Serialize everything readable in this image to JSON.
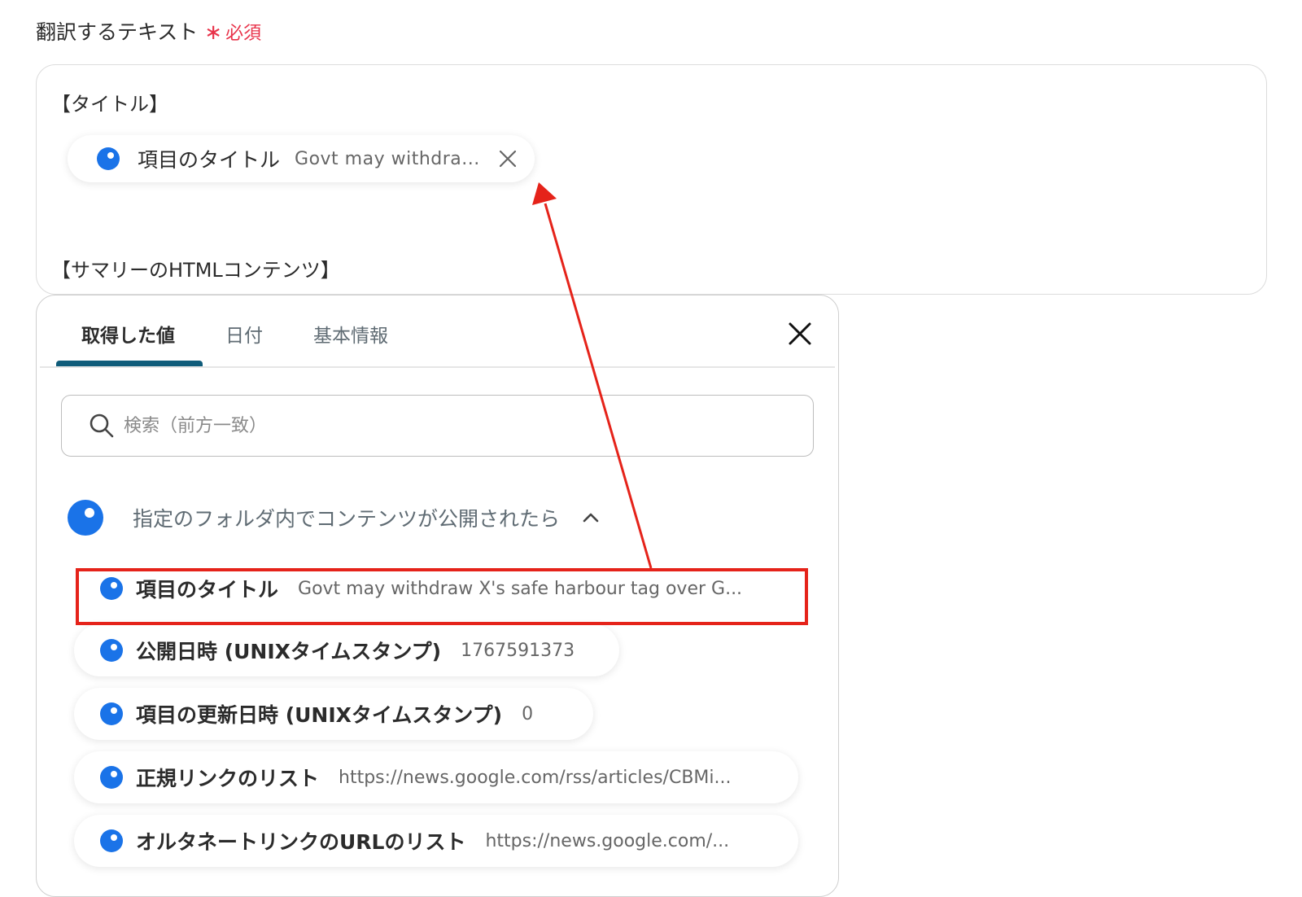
{
  "field": {
    "label": "翻訳するテキスト",
    "required_star": "∗",
    "required_text": "必須"
  },
  "editor": {
    "line1": "【タイトル】",
    "line2": "【サマリーのHTMLコンテンツ】",
    "token": {
      "label": "項目のタイトル",
      "value": "Govt may withdra..."
    }
  },
  "picker": {
    "tabs": [
      {
        "label": "取得した値",
        "active": true
      },
      {
        "label": "日付",
        "active": false
      },
      {
        "label": "基本情報",
        "active": false
      }
    ],
    "search": {
      "placeholder": "検索（前方一致）",
      "value": ""
    },
    "group": {
      "title": "指定のフォルダ内でコンテンツが公開されたら"
    },
    "items": [
      {
        "label": "項目のタイトル",
        "value": "Govt may withdraw X's safe harbour tag over G..."
      },
      {
        "label": "公開日時 (UNIXタイムスタンプ)",
        "value": "1767591373"
      },
      {
        "label": "項目の更新日時 (UNIXタイムスタンプ)",
        "value": "0"
      },
      {
        "label": "正規リンクのリスト",
        "value": "https://news.google.com/rss/articles/CBMi..."
      },
      {
        "label": "オルタネートリンクのURLのリスト",
        "value": "https://news.google.com/..."
      }
    ]
  },
  "colors": {
    "accent": "#1a73e8",
    "tab_underline": "#0f5c7a",
    "required": "#e8334a",
    "annotation": "#e5231a"
  }
}
